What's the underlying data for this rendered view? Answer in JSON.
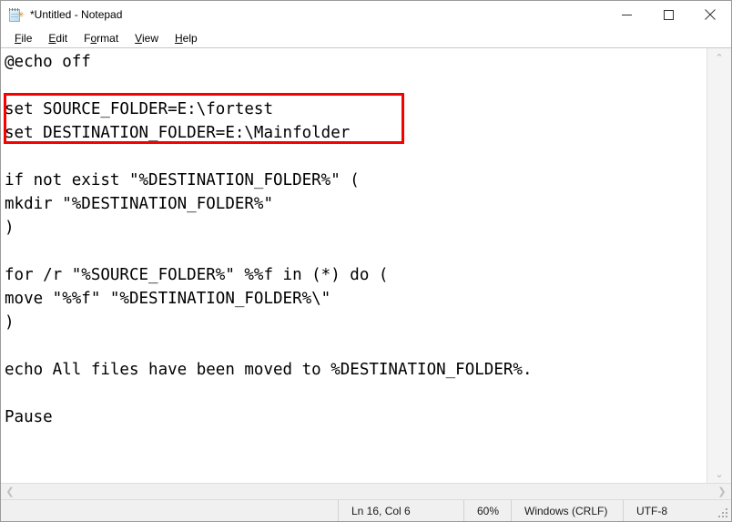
{
  "window": {
    "title": "*Untitled - Notepad",
    "app_icon": "notepad-icon",
    "icon_badge": "✳"
  },
  "caption": {
    "minimize_label": "Minimize",
    "maximize_label": "Maximize",
    "close_label": "Close"
  },
  "menubar": {
    "items": [
      {
        "label": "File",
        "accel_index": 0
      },
      {
        "label": "Edit",
        "accel_index": 0
      },
      {
        "label": "Format",
        "accel_index": 1
      },
      {
        "label": "View",
        "accel_index": 0
      },
      {
        "label": "Help",
        "accel_index": 0
      }
    ]
  },
  "editor": {
    "lines": [
      "@echo off",
      "",
      "set SOURCE_FOLDER=E:\\fortest",
      "set DESTINATION_FOLDER=E:\\Mainfolder",
      "",
      "if not exist \"%DESTINATION_FOLDER%\" (",
      "mkdir \"%DESTINATION_FOLDER%\"",
      ")",
      "",
      "for /r \"%SOURCE_FOLDER%\" %%f in (*) do (",
      "move \"%%f\" \"%DESTINATION_FOLDER%\\\"",
      ")",
      "",
      "echo All files have been moved to %DESTINATION_FOLDER%.",
      "",
      "Pause"
    ],
    "annotation": {
      "color": "#f70000",
      "covers_lines": [
        "set SOURCE_FOLDER=E:\\fortest",
        "set DESTINATION_FOLDER=E:\\Mainfolder"
      ]
    }
  },
  "scrollbars": {
    "vertical": {
      "up_arrow": "⌃",
      "down_arrow": "⌄"
    },
    "horizontal": {
      "left_arrow": "❮",
      "right_arrow": "❯"
    }
  },
  "statusbar": {
    "cursor_position": "Ln 16, Col 6",
    "zoom": "60%",
    "line_ending": "Windows (CRLF)",
    "encoding": "UTF-8"
  }
}
